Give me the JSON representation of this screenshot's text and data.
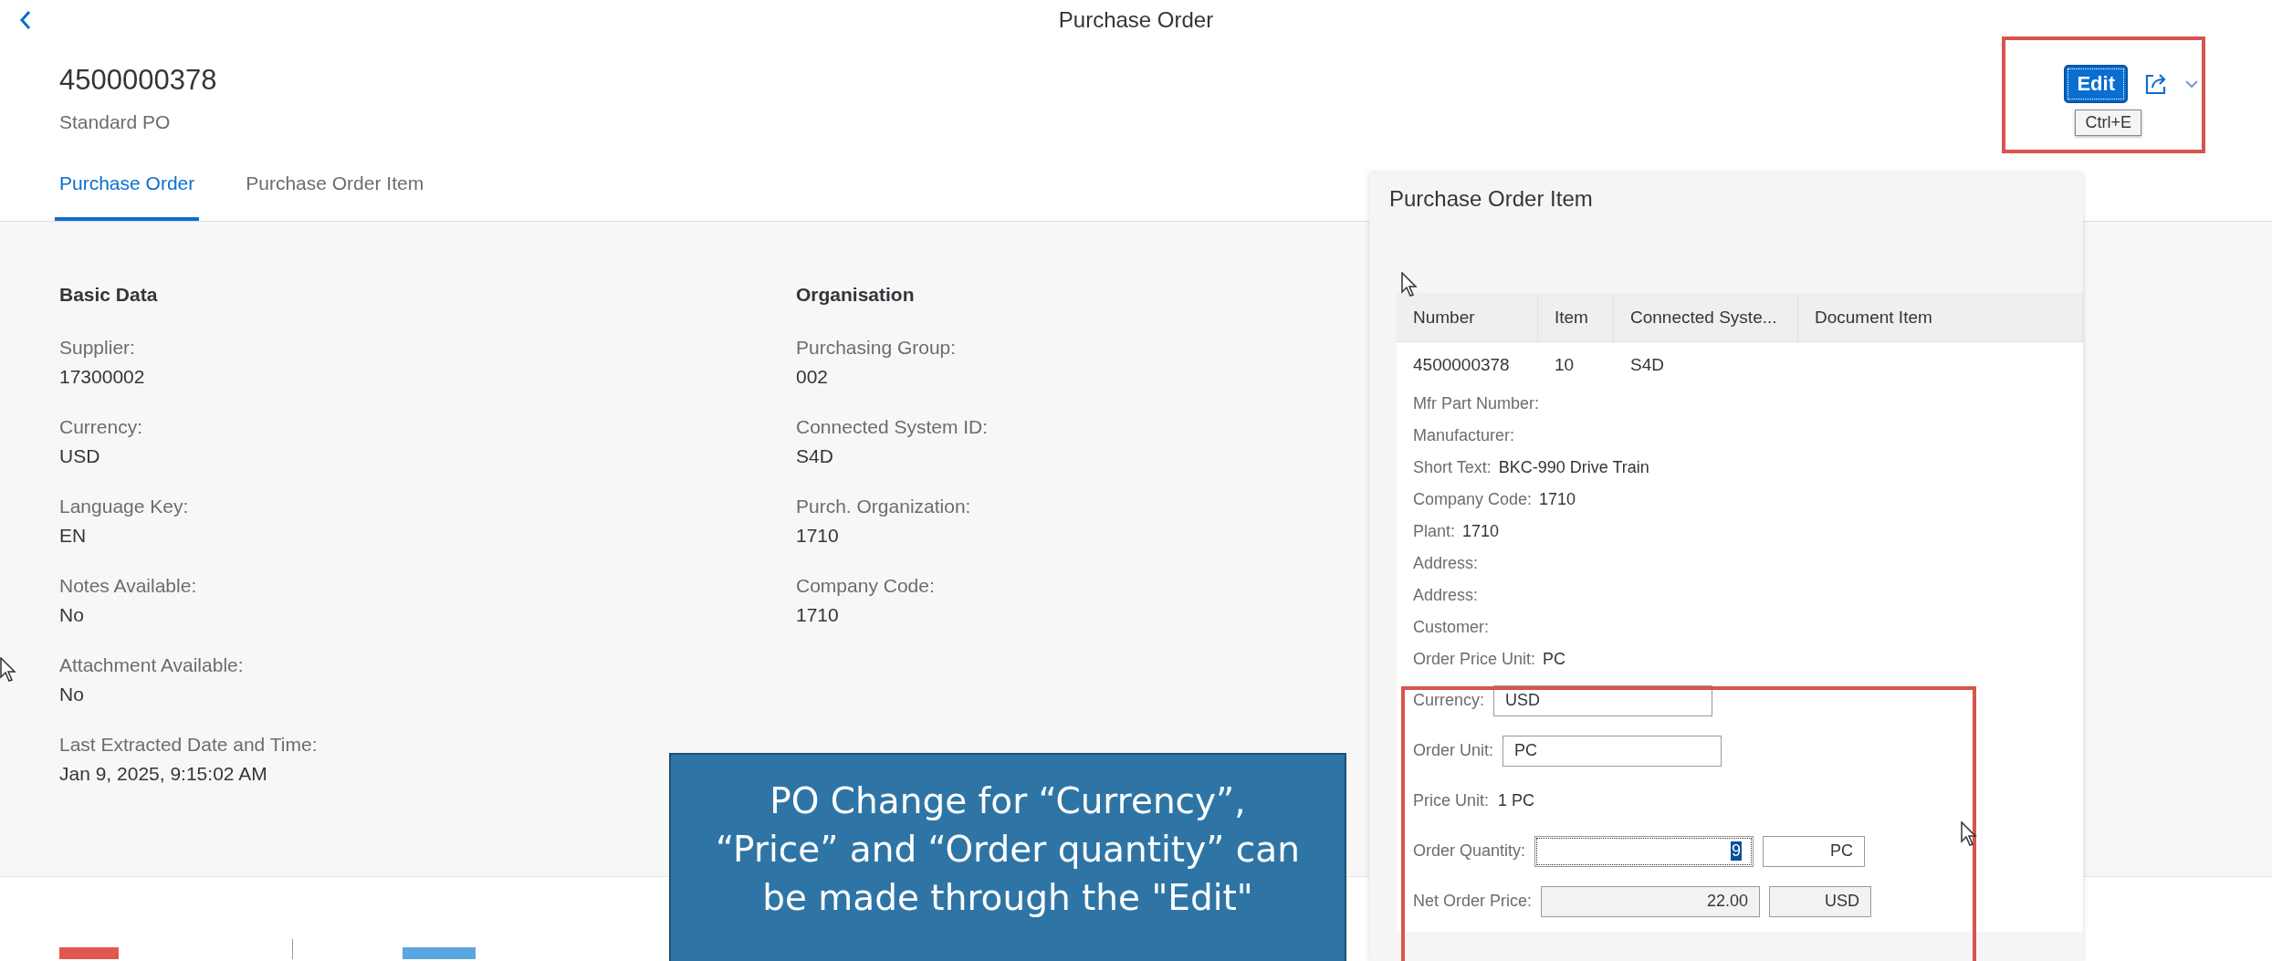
{
  "header": {
    "title": "Purchase Order"
  },
  "object": {
    "number": "4500000378",
    "subtitle": "Standard PO"
  },
  "actions": {
    "edit": "Edit",
    "tooltip": "Ctrl+E"
  },
  "tabs": [
    {
      "label": "Purchase Order",
      "selected": true
    },
    {
      "label": "Purchase Order Item",
      "selected": false
    }
  ],
  "sections": [
    {
      "title": "Basic Data",
      "fields": [
        {
          "label": "Supplier:",
          "value": "17300002"
        },
        {
          "label": "Currency:",
          "value": "USD"
        },
        {
          "label": "Language Key:",
          "value": "EN"
        },
        {
          "label": "Notes Available:",
          "value": "No"
        },
        {
          "label": "Attachment Available:",
          "value": "No"
        },
        {
          "label": "Last Extracted Date and Time:",
          "value": "Jan 9, 2025, 9:15:02 AM"
        }
      ]
    },
    {
      "title": "Organisation",
      "fields": [
        {
          "label": "Purchasing Group:",
          "value": "002"
        },
        {
          "label": "Connected System ID:",
          "value": "S4D"
        },
        {
          "label": "Purch. Organization:",
          "value": "1710"
        },
        {
          "label": "Company Code:",
          "value": "1710"
        }
      ]
    }
  ],
  "item_dialog": {
    "title": "Purchase Order Item",
    "columns": [
      "Number",
      "Item",
      "Connected Syste...",
      "Document Item"
    ],
    "row": [
      "4500000378",
      "10",
      "S4D"
    ],
    "details": [
      {
        "label": "Mfr Part Number:"
      },
      {
        "label": "Manufacturer:"
      },
      {
        "label": "Short Text:",
        "value": "BKC-990 Drive Train"
      },
      {
        "label": "Company Code:",
        "value": "1710"
      },
      {
        "label": "Plant:",
        "value": "1710"
      },
      {
        "label": "Address:"
      },
      {
        "label": "Address:"
      },
      {
        "label": "Customer:"
      },
      {
        "label": "Order Price Unit:",
        "value": "PC"
      }
    ],
    "form": [
      {
        "kind": "input",
        "label": "Currency:",
        "value": "USD"
      },
      {
        "kind": "input",
        "label": "Order Unit:",
        "value": "PC"
      },
      {
        "kind": "text",
        "label": "Price Unit:",
        "value": "1 PC"
      },
      {
        "kind": "pair",
        "label": "Order Quantity:",
        "value": "9",
        "unit": "PC",
        "focused": true,
        "readonly": false
      },
      {
        "kind": "pair",
        "label": "Net Order Price:",
        "value": "22.00",
        "unit": "USD",
        "focused": false,
        "readonly": true
      }
    ]
  },
  "callout": {
    "lines": [
      "PO Change for “Currency”,",
      "“Price” and “Order quantity” can",
      "be made through the \"Edit\""
    ]
  }
}
